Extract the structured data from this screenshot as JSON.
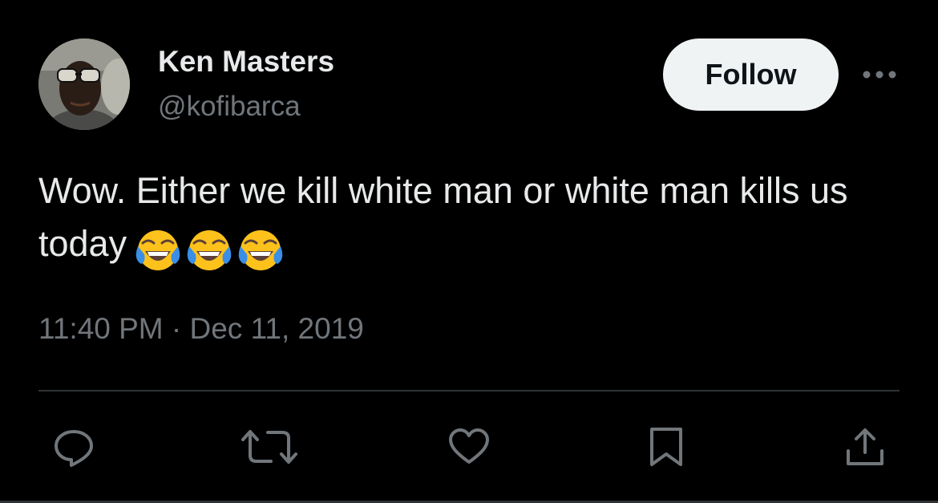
{
  "author": {
    "display_name": "Ken Masters",
    "handle": "@kofibarca"
  },
  "header": {
    "follow_label": "Follow",
    "more_icon": "more-horizontal-icon"
  },
  "tweet": {
    "text": "Wow. Either we kill white man or white man kills us today",
    "emojis": [
      "face-with-tears-of-joy",
      "face-with-tears-of-joy",
      "face-with-tears-of-joy"
    ],
    "timestamp": "11:40 PM · Dec 11, 2019"
  },
  "actions": [
    {
      "name": "reply",
      "icon": "reply-icon"
    },
    {
      "name": "retweet",
      "icon": "retweet-icon"
    },
    {
      "name": "like",
      "icon": "heart-icon"
    },
    {
      "name": "bookmark",
      "icon": "bookmark-icon"
    },
    {
      "name": "share",
      "icon": "share-icon"
    }
  ],
  "colors": {
    "background": "#000000",
    "primary_text": "#e7e9ea",
    "secondary_text": "#71767b",
    "follow_button_bg": "#eff3f4",
    "divider": "#2f3336"
  }
}
